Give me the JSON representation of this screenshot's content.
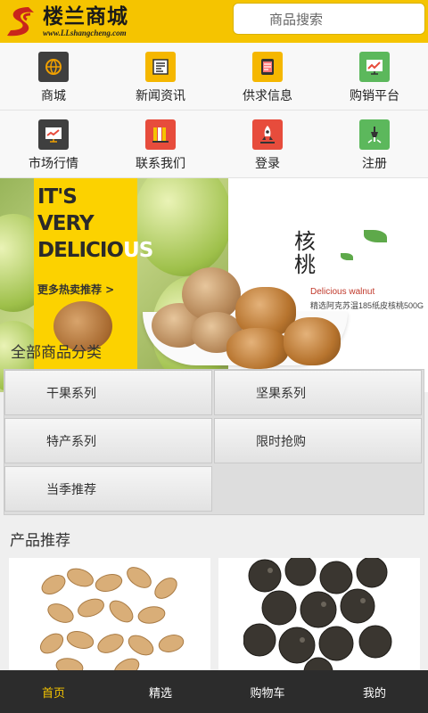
{
  "header": {
    "logo_title": "楼兰商城",
    "logo_sub": "www.LLshangcheng.com",
    "search_placeholder": "商品搜索"
  },
  "nav": {
    "items": [
      {
        "label": "商城",
        "icon": "globe-icon",
        "color": "#3f3f3f"
      },
      {
        "label": "新闻资讯",
        "icon": "newspaper-icon",
        "color": "#f5b700"
      },
      {
        "label": "供求信息",
        "icon": "document-icon",
        "color": "#f5b700"
      },
      {
        "label": "购销平台",
        "icon": "chart-screen-icon",
        "color": "#5cb85c"
      },
      {
        "label": "市场行情",
        "icon": "monitor-icon",
        "color": "#3f3f3f"
      },
      {
        "label": "联系我们",
        "icon": "books-icon",
        "color": "#e74c3c"
      },
      {
        "label": "登录",
        "icon": "rocket-icon",
        "color": "#e74c3c"
      },
      {
        "label": "注册",
        "icon": "pen-icon",
        "color": "#5cb85c"
      }
    ]
  },
  "banner": {
    "line1": "IT'S",
    "line2": "VERY",
    "line3a": "DELICIO",
    "line3b": "US",
    "more": "更多热卖推荐 >",
    "hetao": "核桃",
    "en_name": "Delicious walnut",
    "desc": "精选阿克苏温185纸皮核桃500G"
  },
  "categories": {
    "title": "全部商品分类",
    "items": [
      "干果系列",
      "坚果系列",
      "特产系列",
      "限时抢购",
      "当季推荐"
    ]
  },
  "products": {
    "title": "产品推荐"
  },
  "tabbar": {
    "items": [
      "首页",
      "精选",
      "购物车",
      "我的"
    ],
    "active": "首页",
    "active_color": "#f5c400"
  },
  "colors": {
    "brand_yellow": "#f5c400",
    "tabbar_bg": "#2c2c2c"
  }
}
